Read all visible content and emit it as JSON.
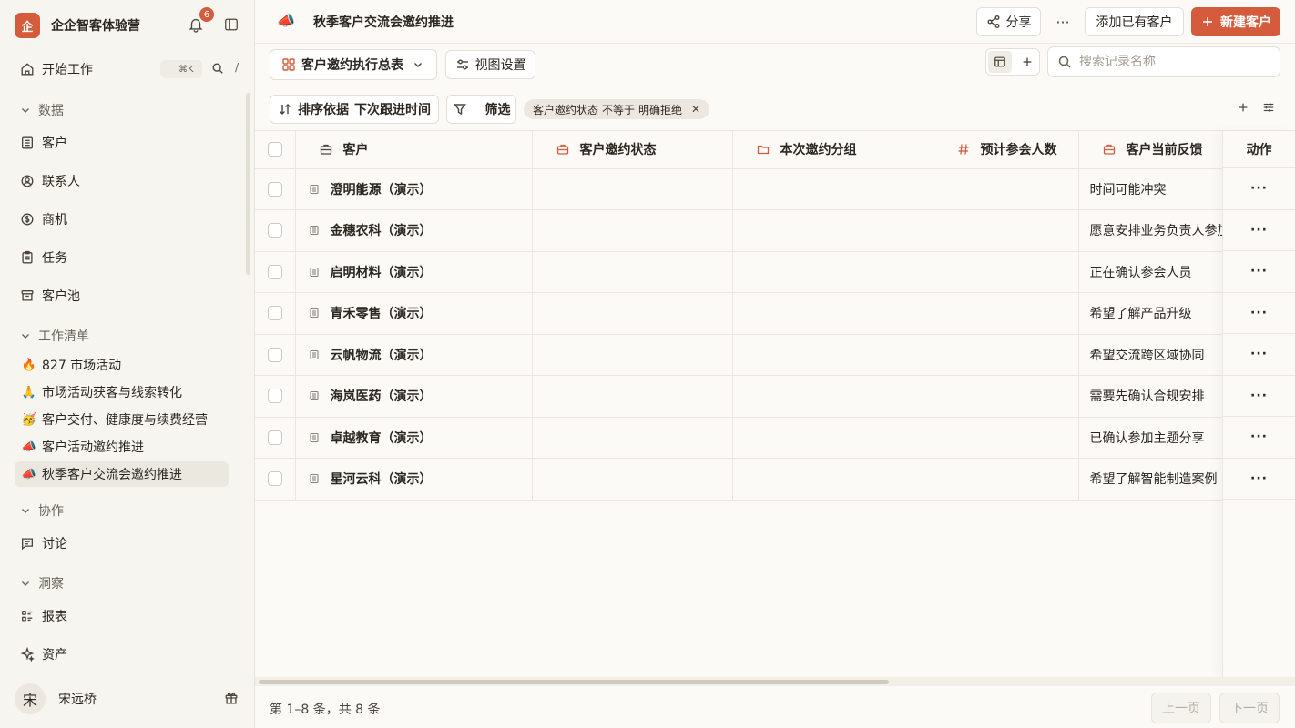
{
  "workspace": {
    "logo_char": "企",
    "name": "企企智客体验营",
    "notification_count": "6"
  },
  "nav": {
    "home": {
      "label": "开始工作",
      "shortcut": "⌘K",
      "slash": "/"
    },
    "sections": {
      "data": "数据",
      "worklist": "工作清单",
      "collab": "协作",
      "insight": "洞察"
    },
    "data_items": [
      "客户",
      "联系人",
      "商机",
      "任务",
      "客户池"
    ],
    "worklist_items": [
      {
        "emoji": "🔥",
        "label": "827 市场活动"
      },
      {
        "emoji": "🙏",
        "label": "市场活动获客与线索转化"
      },
      {
        "emoji": "🥳",
        "label": "客户交付、健康度与续费经营"
      },
      {
        "emoji": "📣",
        "label": "客户活动邀约推进"
      },
      {
        "emoji": "📣",
        "label": "秋季客户交流会邀约推进"
      }
    ],
    "collab_items": [
      "讨论"
    ],
    "insight_items": [
      "报表",
      "资产"
    ]
  },
  "user": {
    "avatar_char": "宋",
    "name": "宋远桥"
  },
  "header": {
    "icon": "📣",
    "title": "秋季客户交流会邀约推进",
    "share_label": "分享",
    "more_label": "···",
    "add_existing_label": "添加已有客户",
    "new_label": "新建客户"
  },
  "toolbar": {
    "view_name": "客户邀约执行总表",
    "view_settings_label": "视图设置",
    "search_placeholder": "搜索记录名称"
  },
  "filterbar": {
    "sort_prefix": "排序依据",
    "sort_field": "下次跟进时间",
    "filter_label": "筛选",
    "chip_field": "客户邀约状态",
    "chip_op": "不等于",
    "chip_value": "明确拒绝"
  },
  "table": {
    "columns": [
      "客户",
      "客户邀约状态",
      "本次邀约分组",
      "预计参会人数",
      "客户当前反馈"
    ],
    "action_header": "动作",
    "action_glyph": "···",
    "rows": [
      {
        "name": "澄明能源（演示）",
        "status": "",
        "group": "",
        "count": "",
        "feedback": "时间可能冲突"
      },
      {
        "name": "金穗农科（演示）",
        "status": "",
        "group": "",
        "count": "",
        "feedback": "愿意安排业务负责人参加"
      },
      {
        "name": "启明材料（演示）",
        "status": "",
        "group": "",
        "count": "",
        "feedback": "正在确认参会人员"
      },
      {
        "name": "青禾零售（演示）",
        "status": "",
        "group": "",
        "count": "",
        "feedback": "希望了解产品升级"
      },
      {
        "name": "云帆物流（演示）",
        "status": "",
        "group": "",
        "count": "",
        "feedback": "希望交流跨区域协同"
      },
      {
        "name": "海岚医药（演示）",
        "status": "",
        "group": "",
        "count": "",
        "feedback": "需要先确认合规安排"
      },
      {
        "name": "卓越教育（演示）",
        "status": "",
        "group": "",
        "count": "",
        "feedback": "已确认参加主题分享"
      },
      {
        "name": "星河云科（演示）",
        "status": "",
        "group": "",
        "count": "",
        "feedback": "希望了解智能制造案例"
      }
    ]
  },
  "footer": {
    "summary": "第 1–8 条，共 8 条",
    "prev_label": "上一页",
    "next_label": "下一页"
  },
  "colors": {
    "accent": "#d45c3c",
    "sidebar_bg": "#f7f5f0",
    "page_bg": "#fbfaf7"
  }
}
